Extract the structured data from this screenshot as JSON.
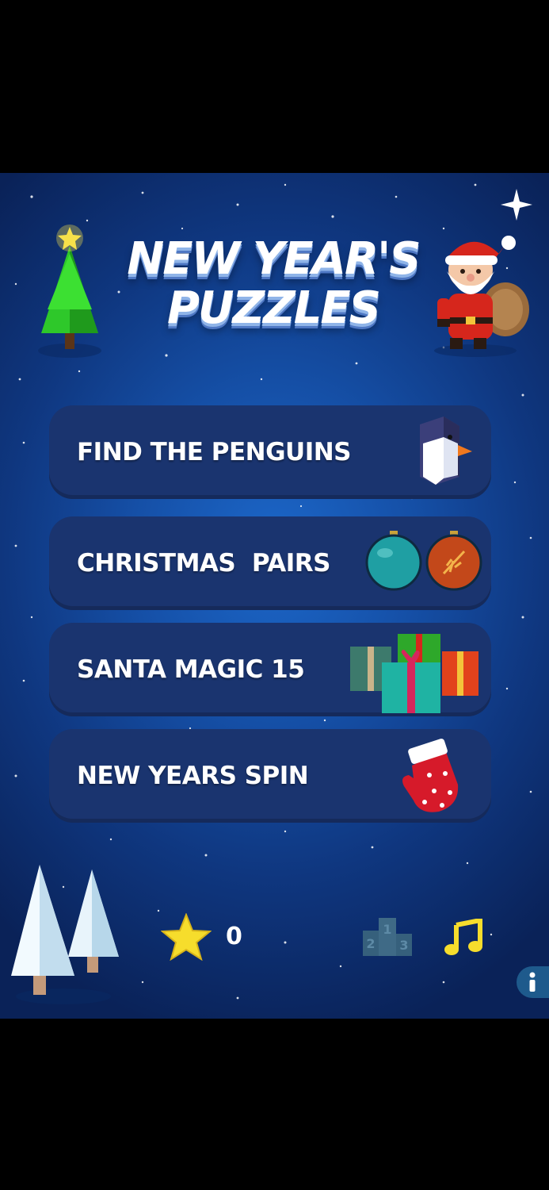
{
  "title": {
    "line1": "NEW YEAR'S",
    "line2": "PUZZLES"
  },
  "menu": [
    {
      "label": "FIND THE PENGUINS",
      "icon": "penguin-icon"
    },
    {
      "label": "CHRISTMAS  PAIRS",
      "icon": "ornaments-icon"
    },
    {
      "label": "SANTA MAGIC 15",
      "icon": "gifts-icon"
    },
    {
      "label": "NEW YEARS SPIN",
      "icon": "mitten-icon"
    }
  ],
  "footer": {
    "stars_count": "0",
    "leaderboard_icon": "podium-icon",
    "music_icon": "music-note-icon",
    "info_icon": "info-icon"
  },
  "colors": {
    "button_bg": "#1a346f",
    "background": "#1c67c9",
    "star": "#f6dd2c",
    "music": "#f6dd2c"
  }
}
